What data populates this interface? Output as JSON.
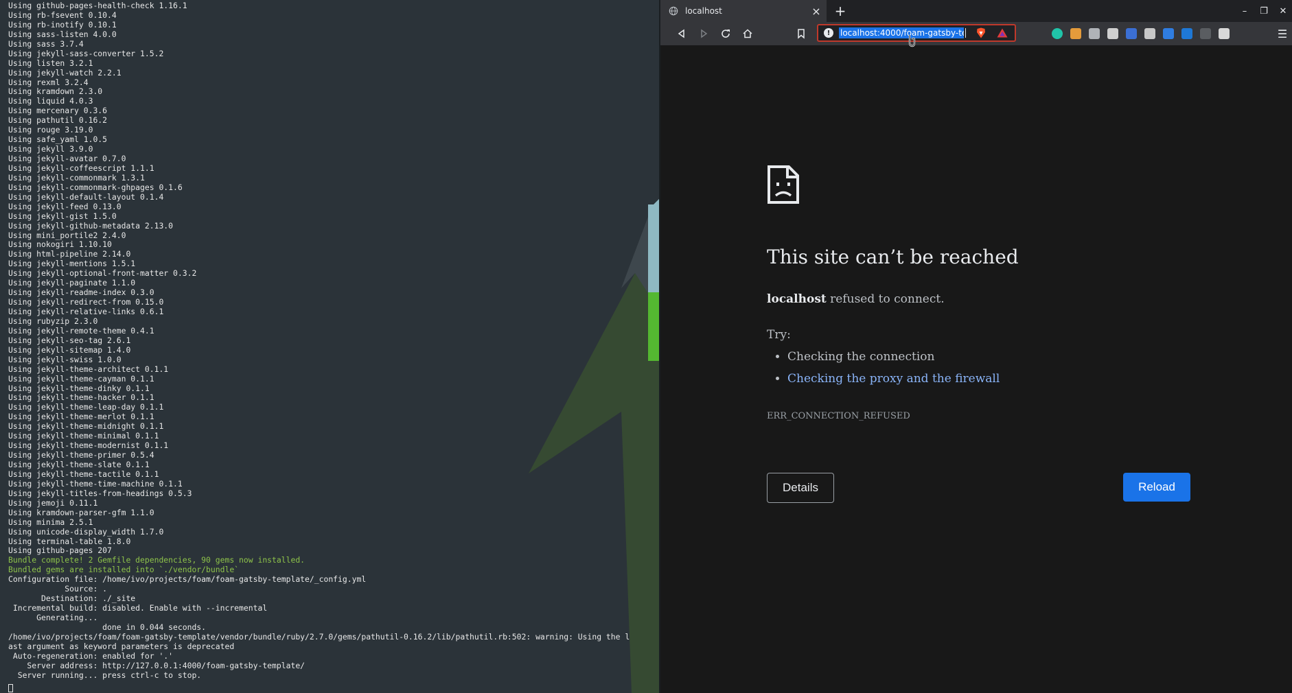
{
  "terminal": {
    "lines": [
      {
        "text": "Using github-pages-health-check 1.16.1"
      },
      {
        "text": "Using rb-fsevent 0.10.4"
      },
      {
        "text": "Using rb-inotify 0.10.1"
      },
      {
        "text": "Using sass-listen 4.0.0"
      },
      {
        "text": "Using sass 3.7.4"
      },
      {
        "text": "Using jekyll-sass-converter 1.5.2"
      },
      {
        "text": "Using listen 3.2.1"
      },
      {
        "text": "Using jekyll-watch 2.2.1"
      },
      {
        "text": "Using rexml 3.2.4"
      },
      {
        "text": "Using kramdown 2.3.0"
      },
      {
        "text": "Using liquid 4.0.3"
      },
      {
        "text": "Using mercenary 0.3.6"
      },
      {
        "text": "Using pathutil 0.16.2"
      },
      {
        "text": "Using rouge 3.19.0"
      },
      {
        "text": "Using safe_yaml 1.0.5"
      },
      {
        "text": "Using jekyll 3.9.0"
      },
      {
        "text": "Using jekyll-avatar 0.7.0"
      },
      {
        "text": "Using jekyll-coffeescript 1.1.1"
      },
      {
        "text": "Using jekyll-commonmark 1.3.1"
      },
      {
        "text": "Using jekyll-commonmark-ghpages 0.1.6"
      },
      {
        "text": "Using jekyll-default-layout 0.1.4"
      },
      {
        "text": "Using jekyll-feed 0.13.0"
      },
      {
        "text": "Using jekyll-gist 1.5.0"
      },
      {
        "text": "Using jekyll-github-metadata 2.13.0"
      },
      {
        "text": "Using mini_portile2 2.4.0"
      },
      {
        "text": "Using nokogiri 1.10.10"
      },
      {
        "text": "Using html-pipeline 2.14.0"
      },
      {
        "text": "Using jekyll-mentions 1.5.1"
      },
      {
        "text": "Using jekyll-optional-front-matter 0.3.2"
      },
      {
        "text": "Using jekyll-paginate 1.1.0"
      },
      {
        "text": "Using jekyll-readme-index 0.3.0"
      },
      {
        "text": "Using jekyll-redirect-from 0.15.0"
      },
      {
        "text": "Using jekyll-relative-links 0.6.1"
      },
      {
        "text": "Using rubyzip 2.3.0"
      },
      {
        "text": "Using jekyll-remote-theme 0.4.1"
      },
      {
        "text": "Using jekyll-seo-tag 2.6.1"
      },
      {
        "text": "Using jekyll-sitemap 1.4.0"
      },
      {
        "text": "Using jekyll-swiss 1.0.0"
      },
      {
        "text": "Using jekyll-theme-architect 0.1.1"
      },
      {
        "text": "Using jekyll-theme-cayman 0.1.1"
      },
      {
        "text": "Using jekyll-theme-dinky 0.1.1"
      },
      {
        "text": "Using jekyll-theme-hacker 0.1.1"
      },
      {
        "text": "Using jekyll-theme-leap-day 0.1.1"
      },
      {
        "text": "Using jekyll-theme-merlot 0.1.1"
      },
      {
        "text": "Using jekyll-theme-midnight 0.1.1"
      },
      {
        "text": "Using jekyll-theme-minimal 0.1.1"
      },
      {
        "text": "Using jekyll-theme-modernist 0.1.1"
      },
      {
        "text": "Using jekyll-theme-primer 0.5.4"
      },
      {
        "text": "Using jekyll-theme-slate 0.1.1"
      },
      {
        "text": "Using jekyll-theme-tactile 0.1.1"
      },
      {
        "text": "Using jekyll-theme-time-machine 0.1.1"
      },
      {
        "text": "Using jekyll-titles-from-headings 0.5.3"
      },
      {
        "text": "Using jemoji 0.11.1"
      },
      {
        "text": "Using kramdown-parser-gfm 1.1.0"
      },
      {
        "text": "Using minima 2.5.1"
      },
      {
        "text": "Using unicode-display_width 1.7.0"
      },
      {
        "text": "Using terminal-table 1.8.0"
      },
      {
        "text": "Using github-pages 207"
      },
      {
        "text": "Bundle complete! 2 Gemfile dependencies, 90 gems now installed.",
        "style": "ok"
      },
      {
        "text": "Bundled gems are installed into `./vendor/bundle`",
        "style": "ok"
      },
      {
        "text": "Configuration file: /home/ivo/projects/foam/foam-gatsby-template/_config.yml"
      },
      {
        "text": "            Source: ."
      },
      {
        "text": "       Destination: ./_site"
      },
      {
        "text": " Incremental build: disabled. Enable with --incremental"
      },
      {
        "text": "      Generating..."
      },
      {
        "text": "                    done in 0.044 seconds."
      },
      {
        "text": "/home/ivo/projects/foam/foam-gatsby-template/vendor/bundle/ruby/2.7.0/gems/pathutil-0.16.2/lib/pathutil.rb:502: warning: Using the l"
      },
      {
        "text": "ast argument as keyword parameters is deprecated"
      },
      {
        "text": " Auto-regeneration: enabled for '.'"
      },
      {
        "text": "    Server address: http://127.0.0.1:4000/foam-gatsby-template/"
      },
      {
        "text": "  Server running... press ctrl-c to stop."
      }
    ]
  },
  "browser": {
    "tab": {
      "title": "localhost",
      "icon": "globe-icon",
      "close_icon": "close-icon"
    },
    "new_tab_label": "+",
    "window_controls": {
      "minimize": "–",
      "restore": "❐",
      "close": "✕"
    },
    "toolbar": {
      "url": "localhost:4000/foam-gatsby-te",
      "info_glyph": "!",
      "menu_glyph": "☰"
    },
    "extensions": [
      {
        "name": "m-extension-icon",
        "color": "#20c4a8"
      },
      {
        "name": "owl-extension-icon",
        "color": "#e49b3b"
      },
      {
        "name": "feather-extension-icon",
        "color": "#b0b3b8"
      },
      {
        "name": "gear-extension-icon",
        "color": "#d0d0d0"
      },
      {
        "name": "pen-extension-icon",
        "color": "#3b6fd4"
      },
      {
        "name": "z-extension-icon",
        "color": "#c8c8c8"
      },
      {
        "name": "help-extension-icon",
        "color": "#2f7de1"
      },
      {
        "name": "translate-extension-icon",
        "color": "#1e78d6"
      },
      {
        "name": "bug-extension-icon",
        "color": "#5a5d61"
      },
      {
        "name": "react-extension-icon",
        "color": "#d8d8d8"
      }
    ],
    "error": {
      "title": "This site can’t be reached",
      "host": "localhost",
      "message": " refused to connect.",
      "try_label": "Try:",
      "suggestions": [
        {
          "text": "Checking the connection",
          "link": false
        },
        {
          "text": "Checking the proxy and the firewall",
          "link": true
        }
      ],
      "code": "ERR_CONNECTION_REFUSED",
      "details_label": "Details",
      "reload_label": "Reload"
    }
  },
  "colors": {
    "terminal_bg": "#2b3339",
    "terminal_ok": "#8ec34a",
    "browser_bg": "#181818",
    "link": "#8ab4f8",
    "reload_bg": "#1a73e8",
    "omnibox_border": "#c0392b"
  }
}
